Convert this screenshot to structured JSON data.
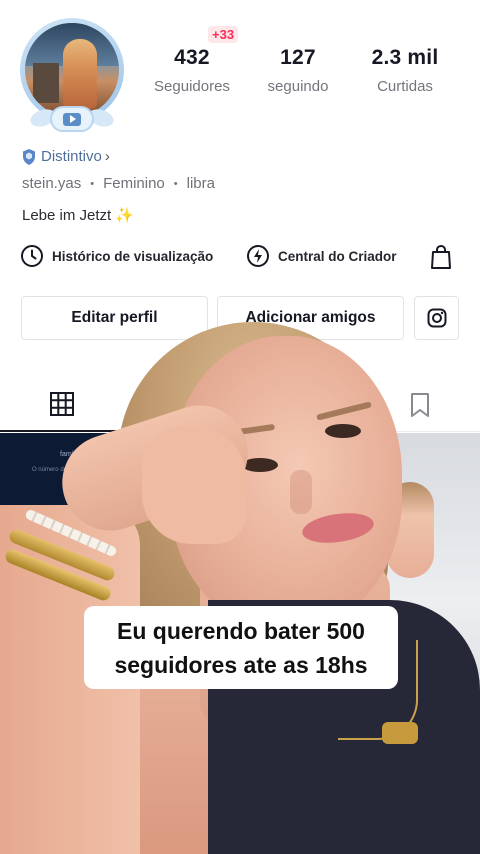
{
  "profile": {
    "stats": [
      {
        "value": "432",
        "label": "Seguidores"
      },
      {
        "value": "127",
        "label": "seguindo"
      },
      {
        "value": "2.3 mil",
        "label": "Curtidas"
      }
    ],
    "new_followers_badge": "+33",
    "badge_label": "Distintivo",
    "badge_chevron": "›",
    "meta": [
      "stein.yas",
      "Feminino",
      "libra"
    ],
    "meta_separator": "•",
    "bio": "Lebe im Jetzt",
    "bio_emoji": "✨"
  },
  "links": {
    "history": "Histórico de visualização",
    "creator": "Central do Criador"
  },
  "buttons": {
    "edit_profile": "Editar perfil",
    "add_friends": "Adicionar amigos"
  },
  "grid": {
    "cell1_title": "família leme",
    "cell1_sub": "O número de membros da família ... amigo 80"
  },
  "overlay": {
    "caption": "Eu querendo bater 500 seguidores ate as 18hs"
  },
  "colors": {
    "accent": "#fe2c55",
    "badge_blue": "#4f6f9a",
    "text_primary": "#161823",
    "text_secondary": "#73757c"
  },
  "icons": {
    "history": "clock-icon",
    "creator": "lightning-badge-icon",
    "shop": "shopping-bag-icon",
    "instagram": "instagram-icon",
    "grid": "grid-icon",
    "saved": "bookmark-icon",
    "badge": "shield-icon"
  }
}
